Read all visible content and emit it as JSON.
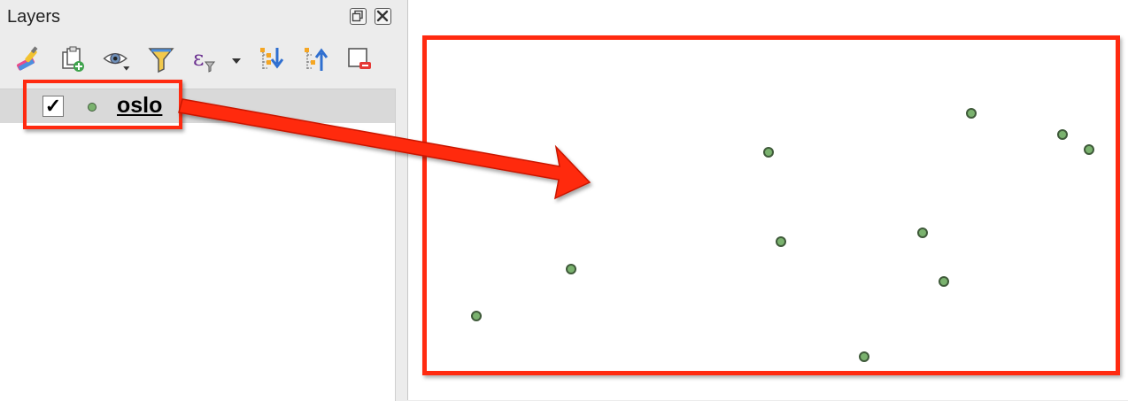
{
  "panel": {
    "title": "Layers",
    "controls": [
      "restore-icon",
      "close-icon"
    ]
  },
  "toolbar": {
    "buttons": [
      {
        "name": "style-brush-icon"
      },
      {
        "name": "add-group-icon"
      },
      {
        "name": "eye-visibility-icon"
      },
      {
        "name": "filter-funnel-icon"
      },
      {
        "name": "expression-filter-icon"
      },
      {
        "name": "expand-all-icon"
      },
      {
        "name": "collapse-all-icon"
      },
      {
        "name": "remove-layer-icon"
      }
    ]
  },
  "layers": [
    {
      "name": "oslo",
      "checked": true,
      "checkmark": "✓"
    }
  ],
  "map": {
    "point_fill": "#7ab26e",
    "point_stroke": "#3f5a3a",
    "highlight_color": "#ff2a10"
  }
}
